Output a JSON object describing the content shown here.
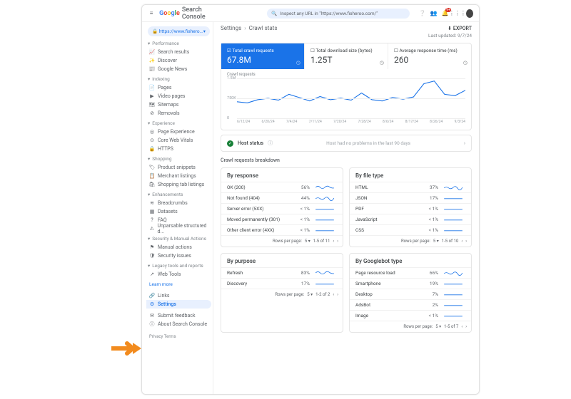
{
  "topbar": {
    "product_name": "Search Console",
    "search_placeholder": "Inspect any URL in \"https://www.fisheroo.com/\""
  },
  "sidebar": {
    "property": "https://www.fishero...",
    "groups": [
      {
        "label": "Performance",
        "items": [
          {
            "icon": "📈",
            "label": "Search results"
          },
          {
            "icon": "✨",
            "label": "Discover"
          },
          {
            "icon": "📰",
            "label": "Google News"
          }
        ]
      },
      {
        "label": "Indexing",
        "items": [
          {
            "icon": "📄",
            "label": "Pages"
          },
          {
            "icon": "▶",
            "label": "Video pages"
          },
          {
            "icon": "🗺",
            "label": "Sitemaps"
          },
          {
            "icon": "⊘",
            "label": "Removals"
          }
        ]
      },
      {
        "label": "Experience",
        "items": [
          {
            "icon": "◎",
            "label": "Page Experience"
          },
          {
            "icon": "⊙",
            "label": "Core Web Vitals"
          },
          {
            "icon": "🔒",
            "label": "HTTPS"
          }
        ]
      },
      {
        "label": "Shopping",
        "items": [
          {
            "icon": "🏷",
            "label": "Product snippets"
          },
          {
            "icon": "📋",
            "label": "Merchant listings"
          },
          {
            "icon": "🛍",
            "label": "Shopping tab listings"
          }
        ]
      },
      {
        "label": "Enhancements",
        "items": [
          {
            "icon": "≋",
            "label": "Breadcrumbs"
          },
          {
            "icon": "▦",
            "label": "Datasets"
          },
          {
            "icon": "?",
            "label": "FAQ"
          },
          {
            "icon": "⚠",
            "label": "Unparsable structured d..."
          }
        ]
      },
      {
        "label": "Security & Manual Actions",
        "items": [
          {
            "icon": "⚑",
            "label": "Manual actions"
          },
          {
            "icon": "🛡",
            "label": "Security issues"
          }
        ]
      },
      {
        "label": "Legacy tools and reports",
        "items": [
          {
            "icon": "↗",
            "label": "Web Tools"
          }
        ]
      }
    ],
    "learn_more": "Learn more",
    "bottom": [
      {
        "icon": "🔗",
        "label": "Links"
      },
      {
        "icon": "⚙",
        "label": "Settings",
        "active": true
      }
    ],
    "footer": [
      {
        "icon": "✉",
        "label": "Submit feedback"
      },
      {
        "icon": "ⓘ",
        "label": "About Search Console"
      }
    ],
    "legal": "Privacy   Terms"
  },
  "main": {
    "breadcrumbs": [
      "Settings",
      "Crawl stats"
    ],
    "export": "EXPORT",
    "last_updated": "Last updated: 9/7/24",
    "metrics": [
      {
        "label": "Total crawl requests",
        "value": "67.8M",
        "icon": "☑",
        "active": true
      },
      {
        "label": "Total download size (bytes)",
        "value": "1.25T",
        "icon": "☐"
      },
      {
        "label": "Average response time (ms)",
        "value": "260",
        "icon": "☐"
      }
    ],
    "chart": {
      "ylabel_top": "Crawl requests",
      "scale_label": "1.5M",
      "yticks": [
        "1.5M",
        "750K",
        "0"
      ],
      "xticks": [
        "6/12/24",
        "6/20/24",
        "7/4/24",
        "7/11/24",
        "7/20/24",
        "7/28/24",
        "8/6/24",
        "8/17/24",
        "8/26/24",
        "9/3/24"
      ]
    },
    "host_status": {
      "title": "Host status",
      "msg": "Host had no problems in the last 90 days"
    },
    "breakdown_title": "Crawl requests breakdown",
    "panels": [
      {
        "title": "By response",
        "rows": [
          {
            "name": "OK (200)",
            "pct": "56%",
            "spark": "wavy"
          },
          {
            "name": "Not found (404)",
            "pct": "44%",
            "spark": "wavyred"
          },
          {
            "name": "Server error (5XX)",
            "pct": "< 1%",
            "spark": "flat"
          },
          {
            "name": "Moved permanently (301)",
            "pct": "< 1%",
            "spark": "flat"
          },
          {
            "name": "Other client error (4XX)",
            "pct": "< 1%",
            "spark": "flat"
          }
        ],
        "pager": {
          "rpp_label": "Rows per page:",
          "rpp": "5",
          "range": "1-5 of 11"
        }
      },
      {
        "title": "By file type",
        "rows": [
          {
            "name": "HTML",
            "pct": "37%",
            "spark": "wavyred"
          },
          {
            "name": "JSON",
            "pct": "17%",
            "spark": "flat"
          },
          {
            "name": "PDF",
            "pct": "< 1%",
            "spark": "flat"
          },
          {
            "name": "JavaScript",
            "pct": "< 1%",
            "spark": "flat"
          },
          {
            "name": "CSS",
            "pct": "< 1%",
            "spark": "flat"
          }
        ],
        "pager": {
          "rpp_label": "Rows per page:",
          "rpp": "5",
          "range": "1-5 of 10"
        }
      },
      {
        "title": "By purpose",
        "rows": [
          {
            "name": "Refresh",
            "pct": "83%",
            "spark": "wavy"
          },
          {
            "name": "Discovery",
            "pct": "17%",
            "spark": "flat"
          }
        ],
        "pager": {
          "rpp_label": "Rows per page:",
          "rpp": "5",
          "range": "1-2 of 2"
        }
      },
      {
        "title": "By Googlebot type",
        "rows": [
          {
            "name": "Page resource load",
            "pct": "66%",
            "spark": "wavyred"
          },
          {
            "name": "Smartphone",
            "pct": "19%",
            "spark": "flat"
          },
          {
            "name": "Desktop",
            "pct": "7%",
            "spark": "flat"
          },
          {
            "name": "AdsBot",
            "pct": "2%",
            "spark": "flat"
          },
          {
            "name": "Image",
            "pct": "< 1%",
            "spark": "flat"
          }
        ],
        "pager": {
          "rpp_label": "Rows per page:",
          "rpp": "5",
          "range": "1-5 of 7"
        }
      }
    ]
  },
  "chart_data": {
    "type": "line",
    "title": "Total crawl requests",
    "ylabel": "Crawl requests",
    "ylim": [
      0,
      1500000
    ],
    "x": [
      "6/12/24",
      "6/16/24",
      "6/20/24",
      "6/24/24",
      "6/28/24",
      "7/2/24",
      "7/6/24",
      "7/10/24",
      "7/14/24",
      "7/18/24",
      "7/22/24",
      "7/26/24",
      "7/30/24",
      "8/3/24",
      "8/7/24",
      "8/11/24",
      "8/15/24",
      "8/19/24",
      "8/23/24",
      "8/27/24",
      "8/31/24",
      "9/3/24",
      "9/7/24"
    ],
    "values": [
      620000,
      580000,
      700000,
      750000,
      680000,
      900000,
      780000,
      650000,
      820000,
      700000,
      760000,
      680000,
      950000,
      700000,
      650000,
      780000,
      720000,
      800000,
      1300000,
      1400000,
      900000,
      850000,
      1050000
    ]
  }
}
